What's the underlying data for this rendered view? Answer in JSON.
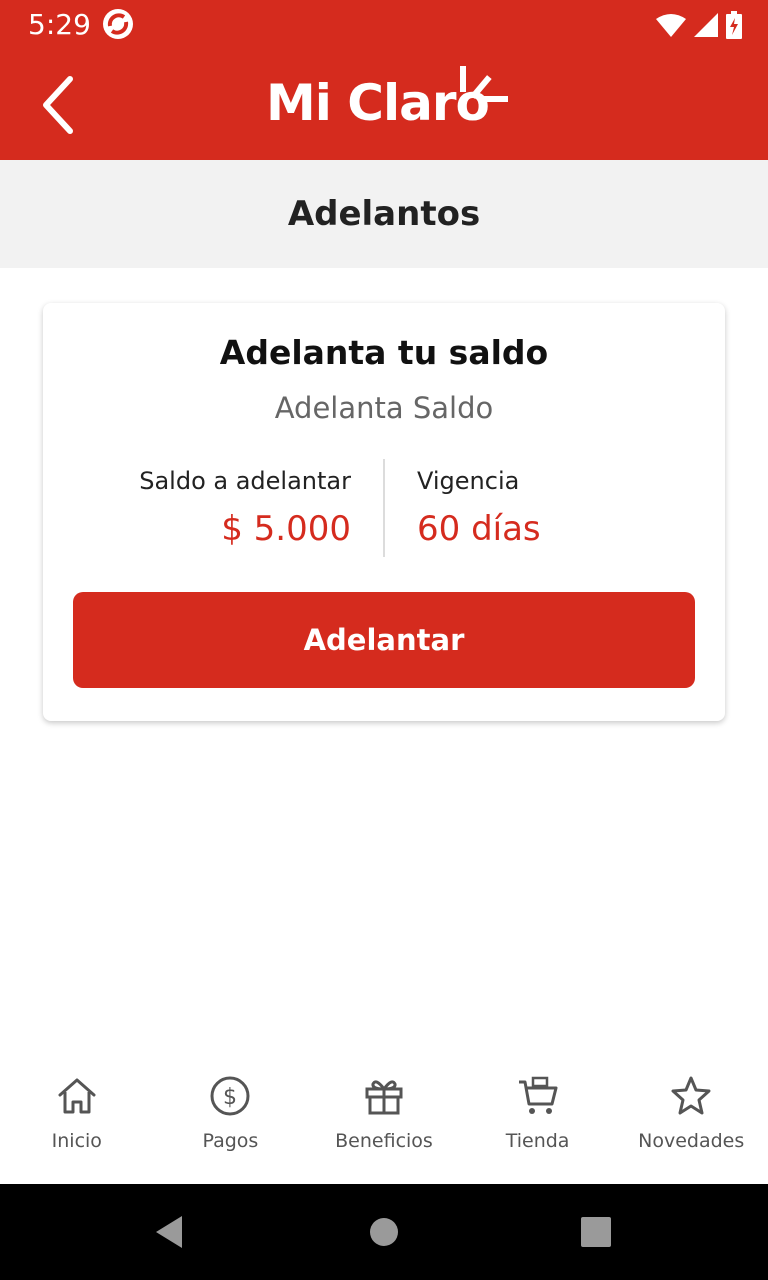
{
  "status_bar": {
    "time": "5:29",
    "icons": [
      "app-notification-icon",
      "wifi-icon",
      "signal-icon",
      "battery-icon"
    ]
  },
  "header": {
    "logo_text": "Mi Claro",
    "brand_color": "#d52b1e",
    "back_icon": "chevron-left-icon"
  },
  "page": {
    "title": "Adelantos"
  },
  "card": {
    "title": "Adelanta tu saldo",
    "subtitle": "Adelanta Saldo",
    "amount_label": "Saldo a adelantar",
    "amount_value": "$ 5.000",
    "validity_label": "Vigencia",
    "validity_value": "60 días",
    "button_label": "Adelantar"
  },
  "tabs": [
    {
      "label": "Inicio",
      "icon": "home-icon"
    },
    {
      "label": "Pagos",
      "icon": "dollar-circle-icon"
    },
    {
      "label": "Beneficios",
      "icon": "gift-icon"
    },
    {
      "label": "Tienda",
      "icon": "cart-icon"
    },
    {
      "label": "Novedades",
      "icon": "star-icon"
    }
  ],
  "system_nav": [
    "back-triangle-icon",
    "home-circle-icon",
    "recents-square-icon"
  ]
}
